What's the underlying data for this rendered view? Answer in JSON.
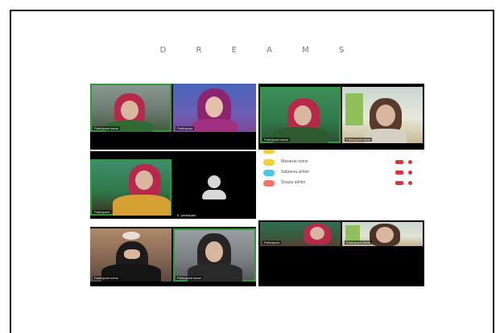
{
  "page": {
    "title": "D R E A M S"
  },
  "tiles": {
    "t1": {
      "name": "Participant name"
    },
    "t2": {
      "name": "Participant"
    },
    "t3": {
      "name": "Participant name"
    },
    "t4": {
      "name": "Participant name"
    },
    "t5": {
      "name": "Participant"
    },
    "t6": {
      "name": "E. participant"
    },
    "t7": {
      "name": "Participant name"
    },
    "t8": {
      "name": "Participant name"
    },
    "t9": {
      "name": "Participant"
    },
    "t10": {
      "name": "Participant name"
    }
  },
  "participants": {
    "rows": [
      {
        "name": "Masarrat name",
        "color": "#f2cf3c"
      },
      {
        "name": "Sabeena akhter",
        "color": "#49c6e5"
      },
      {
        "name": "Shazia akhter",
        "color": "#f07468"
      }
    ],
    "mic_icon": "mic-off-icon",
    "camera_icon": "camera-off-icon"
  },
  "colors": {
    "scarf_red": "#b8284a",
    "scarf_magenta": "#8c2470",
    "active_border": "#2e9a3c",
    "status_red": "#e0303a"
  }
}
